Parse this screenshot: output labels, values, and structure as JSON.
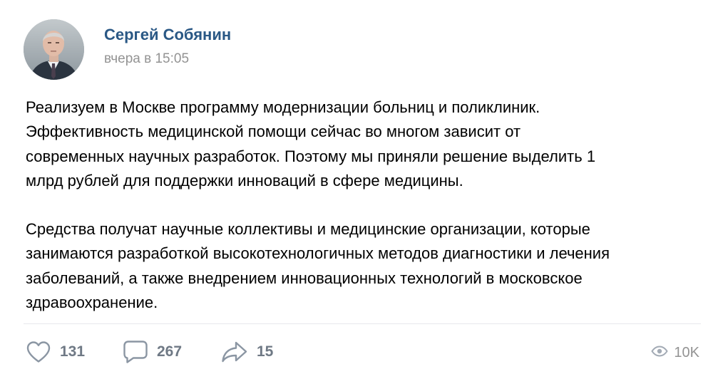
{
  "post": {
    "author": "Сергей Собянин",
    "time": "вчера в 15:05",
    "paragraphs": [
      "Реализуем в Москве программу модернизации больниц и поликлиник.\nЭффективность медицинской помощи сейчас во многом зависит от\nсовременных научных разработок. Поэтому мы приняли решение выделить 1\nмлрд рублей для поддержки инноваций в сфере медицины.",
      "Средства получат научные коллективы и медицинские организации, которые\nзанимаются разработкой высокотехнологичных методов диагностики и лечения\nзаболеваний, а также внедрением инновационных технологий в московское\nздравоохранение."
    ]
  },
  "footer": {
    "likes": "131",
    "comments": "267",
    "shares": "15",
    "views": "10K"
  },
  "icons": {
    "like": "heart-icon",
    "comment": "comment-bubble-icon",
    "share": "share-arrow-icon",
    "views": "eye-icon"
  },
  "colors": {
    "author_link": "#2a5885",
    "secondary_text": "#939393",
    "action_icon": "#8b96a3",
    "divider": "#e7e8ec"
  }
}
